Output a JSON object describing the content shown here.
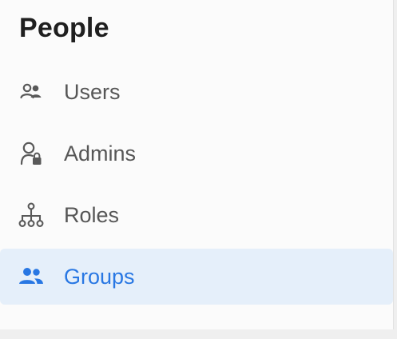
{
  "section": {
    "title": "People"
  },
  "nav": {
    "items": [
      {
        "label": "Users",
        "icon": "users-icon",
        "selected": false
      },
      {
        "label": "Admins",
        "icon": "admin-lock-icon",
        "selected": false
      },
      {
        "label": "Roles",
        "icon": "hierarchy-icon",
        "selected": false
      },
      {
        "label": "Groups",
        "icon": "groups-icon",
        "selected": true
      }
    ]
  },
  "colors": {
    "text": "#565656",
    "title": "#1f1f1f",
    "accent": "#2877e3",
    "selected_background": "#e5effa"
  }
}
